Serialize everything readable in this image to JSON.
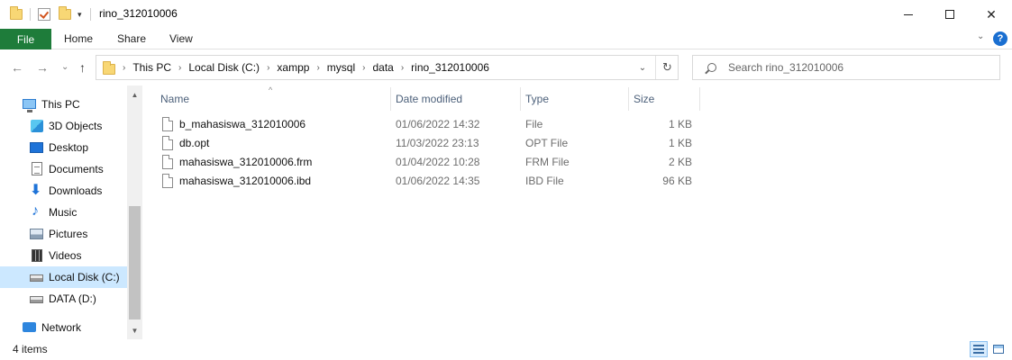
{
  "window": {
    "title": "rino_312010006",
    "minimize_icon": "minimize-icon",
    "maximize_icon": "maximize-icon",
    "close_glyph": "✕"
  },
  "quick_access": {
    "dropdown_glyph": "▾"
  },
  "ribbon": {
    "tabs": [
      "File",
      "Home",
      "Share",
      "View"
    ],
    "expand_glyph": "⌄",
    "help_glyph": "?"
  },
  "nav": {
    "back_glyph": "←",
    "forward_glyph": "→",
    "recent_glyph": "⌄",
    "up_glyph": "↑"
  },
  "address": {
    "breadcrumbs": [
      "This PC",
      "Local Disk (C:)",
      "xampp",
      "mysql",
      "data",
      "rino_312010006"
    ],
    "separator": "›",
    "dropdown_glyph": "⌄",
    "refresh_glyph": "↻"
  },
  "search": {
    "placeholder": "Search rino_312010006"
  },
  "sidebar": {
    "items": [
      {
        "label": "This PC",
        "icon": "this-pc-icon"
      },
      {
        "label": "3D Objects",
        "icon": "cube-icon"
      },
      {
        "label": "Desktop",
        "icon": "desktop-icon"
      },
      {
        "label": "Documents",
        "icon": "documents-icon"
      },
      {
        "label": "Downloads",
        "icon": "download-arrow-icon"
      },
      {
        "label": "Music",
        "icon": "music-note-icon"
      },
      {
        "label": "Pictures",
        "icon": "pictures-icon"
      },
      {
        "label": "Videos",
        "icon": "film-icon"
      },
      {
        "label": "Local Disk (C:)",
        "icon": "drive-icon",
        "selected": true
      },
      {
        "label": "DATA (D:)",
        "icon": "drive-icon"
      },
      {
        "label": "Network",
        "icon": "network-icon"
      }
    ],
    "scroll_up_glyph": "▲",
    "scroll_down_glyph": "▼"
  },
  "file_list": {
    "columns": [
      "Name",
      "Date modified",
      "Type",
      "Size"
    ],
    "sort_glyph": "^",
    "rows": [
      {
        "name": "b_mahasiswa_312010006",
        "date": "01/06/2022 14:32",
        "type": "File",
        "size": "1 KB"
      },
      {
        "name": "db.opt",
        "date": "11/03/2022 23:13",
        "type": "OPT File",
        "size": "1 KB"
      },
      {
        "name": "mahasiswa_312010006.frm",
        "date": "01/04/2022 10:28",
        "type": "FRM File",
        "size": "2 KB"
      },
      {
        "name": "mahasiswa_312010006.ibd",
        "date": "01/06/2022 14:35",
        "type": "IBD File",
        "size": "96 KB"
      }
    ]
  },
  "status": {
    "item_count": "4 items"
  },
  "colors": {
    "file_tab": "#1e7c3a",
    "selection": "#cce8ff",
    "header_text": "#4c607a",
    "help": "#1a6fd1"
  }
}
